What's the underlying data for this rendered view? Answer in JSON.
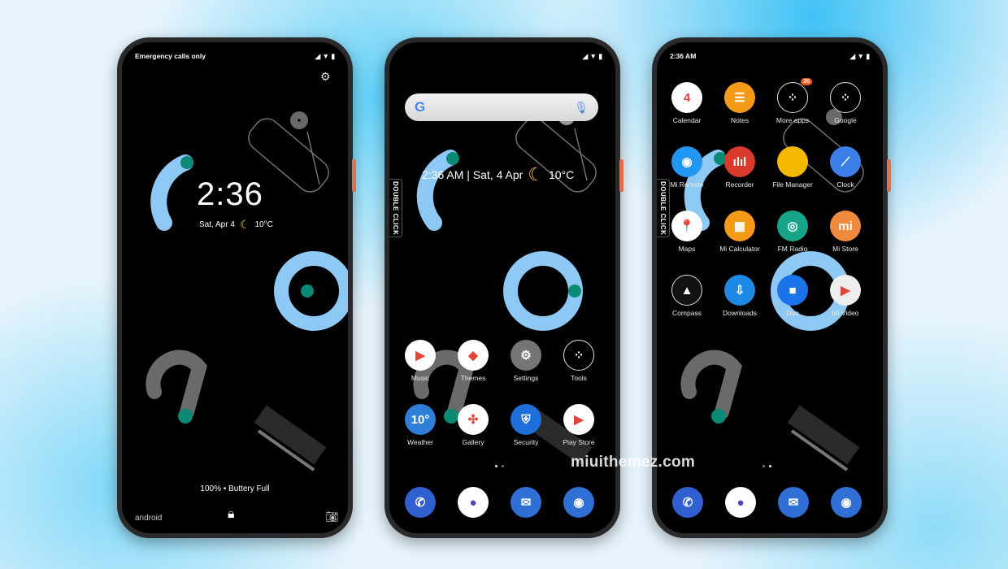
{
  "lockscreen": {
    "status_text": "Emergency calls only",
    "time": "2:36",
    "date": "Sat, Apr 4",
    "temperature": "10°C",
    "battery_text": "100% • Buttery Full",
    "android_logo": "android",
    "icons": [
      "settings-icon",
      "lock-icon",
      "camera-icon",
      "moon-icon"
    ]
  },
  "home": {
    "search_placeholder": "",
    "widget": {
      "time_date": "2:36 AM | Sat, 4 Apr",
      "temperature": "10°C"
    },
    "double_click": "DOUBLE CLICK",
    "apps": [
      {
        "label": "Music",
        "color": "#ffffff",
        "glyph": "▶"
      },
      {
        "label": "Themes",
        "color": "#ffffff",
        "glyph": "◆"
      },
      {
        "label": "Settings",
        "color": "#757575",
        "glyph": "⚙"
      },
      {
        "label": "Tools",
        "color": "#000000",
        "glyph": "⁘"
      },
      {
        "label": "Weather",
        "color": "#2f7fd8",
        "glyph": "10°"
      },
      {
        "label": "Gallery",
        "color": "#ffffff",
        "glyph": "✣"
      },
      {
        "label": "Security",
        "color": "#1e6fd9",
        "glyph": "⛨"
      },
      {
        "label": "Play Store",
        "color": "#ffffff",
        "glyph": "▶"
      }
    ],
    "page": 1,
    "pages": 2
  },
  "drawer": {
    "status_time": "2:36 AM",
    "double_click": "DOUBLE CLICK",
    "apps": [
      {
        "label": "Calendar",
        "color": "#ffffff",
        "glyph": "4"
      },
      {
        "label": "Notes",
        "color": "#f59a17",
        "glyph": "☰"
      },
      {
        "label": "More apps",
        "color": "#000000",
        "glyph": "⁘",
        "badge": "20"
      },
      {
        "label": "Google",
        "color": "#000000",
        "glyph": "⁘"
      },
      {
        "label": "Mi Remote",
        "color": "#2196f3",
        "glyph": "◉"
      },
      {
        "label": "Recorder",
        "color": "#d93a2b",
        "glyph": "ılıl"
      },
      {
        "label": "File Manager",
        "color": "#f5b800",
        "glyph": ""
      },
      {
        "label": "Clock",
        "color": "#3c7ee8",
        "glyph": "⟋"
      },
      {
        "label": "Maps",
        "color": "#ffffff",
        "glyph": "📍"
      },
      {
        "label": "Mi Calculator",
        "color": "#f59a17",
        "glyph": "▦"
      },
      {
        "label": "FM Radio",
        "color": "#17a589",
        "glyph": "◎"
      },
      {
        "label": "Mi Store",
        "color": "#f08a3c",
        "glyph": "mi"
      },
      {
        "label": "Compass",
        "color": "#111111",
        "glyph": "▲"
      },
      {
        "label": "Downloads",
        "color": "#1e88e5",
        "glyph": "⇩"
      },
      {
        "label": "Duo",
        "color": "#1a73e8",
        "glyph": "■"
      },
      {
        "label": "Mi Video",
        "color": "#eeeeee",
        "glyph": "▶"
      }
    ],
    "page": 2,
    "pages": 2
  },
  "dock": [
    {
      "name": "phone",
      "color": "#2f5fd0",
      "glyph": "✆"
    },
    {
      "name": "browser",
      "color": "#ffffff",
      "glyph": "●"
    },
    {
      "name": "messages",
      "color": "#2f6fd6",
      "glyph": "✉"
    },
    {
      "name": "camera",
      "color": "#2f6fd6",
      "glyph": "◉"
    }
  ],
  "watermark": "miuithemez.com",
  "colors": {
    "wallpaper_blue": "#8ec8f5",
    "wallpaper_teal": "#0a8a74",
    "wallpaper_gray": "#6a6a6a"
  }
}
